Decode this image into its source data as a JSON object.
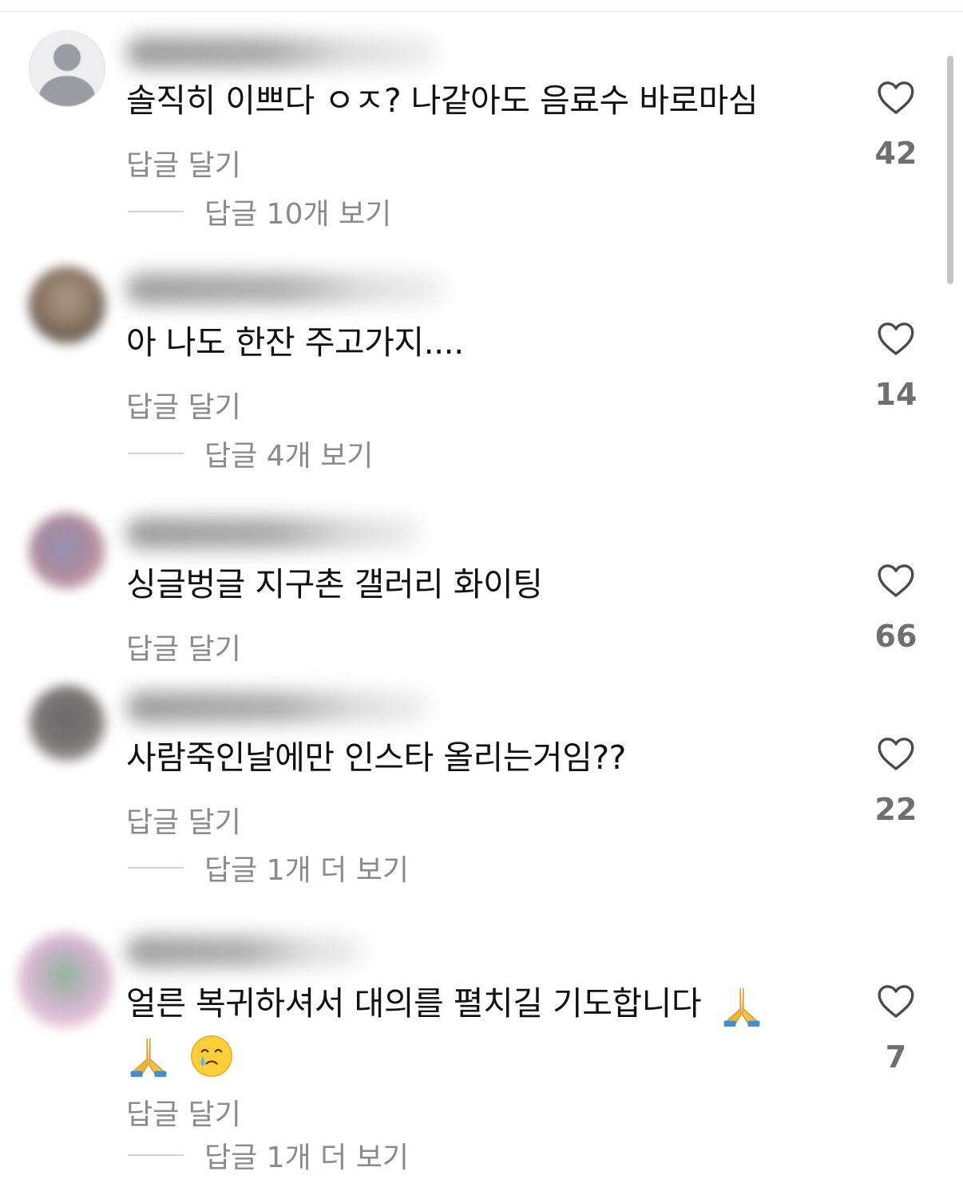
{
  "comments": [
    {
      "text": "솔직히 이쁘다 ㅇㅈ? 나같아도 음료수 바로마심",
      "reply_label": "답글 달기",
      "likes": "42",
      "view_replies": "답글 10개 보기"
    },
    {
      "text": "아 나도 한잔 주고가지....",
      "reply_label": "답글 달기",
      "likes": "14",
      "view_replies": "답글 4개 보기"
    },
    {
      "text": "싱글벙글 지구촌 갤러리 화이팅",
      "reply_label": "답글 달기",
      "likes": "66"
    },
    {
      "text": "사람죽인날에만 인스타 올리는거임??",
      "reply_label": "답글 달기",
      "likes": "22",
      "view_replies": "답글 1개 더 보기"
    },
    {
      "text": "얼른 복귀하셔서 대의를 펼치길 기도합니다",
      "emojis": [
        "folded-hands",
        "folded-hands",
        "face-holding-back-tears"
      ],
      "reply_label": "답글 달기",
      "likes": "7",
      "view_replies": "답글 1개 더 보기"
    }
  ],
  "icons": {
    "like": "heart-outline-icon"
  },
  "colors": {
    "text": "#111111",
    "secondary_text": "#8a8a8a",
    "like_count": "#6f6f6f"
  }
}
